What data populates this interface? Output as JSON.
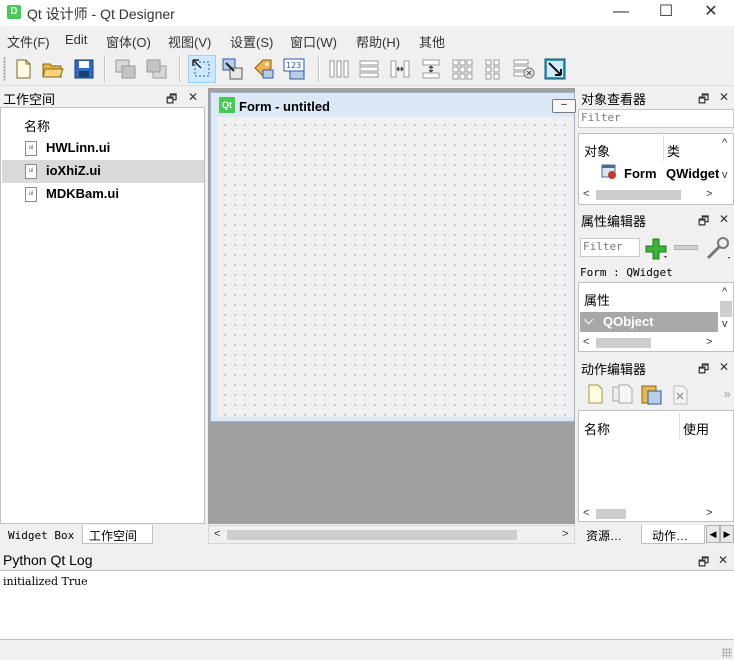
{
  "window": {
    "title": "Qt 设计师 - Qt Designer",
    "app_icon_letter": "D"
  },
  "window_controls": {
    "minimize": "—",
    "maximize": "☐",
    "close": "✕"
  },
  "menubar": {
    "items": [
      "文件(F)",
      "Edit",
      "窗体(O)",
      "视图(V)",
      "设置(S)",
      "窗口(W)",
      "帮助(H)",
      "其他"
    ]
  },
  "toolbar": {
    "buttons": [
      "new-form",
      "open-form",
      "save-form",
      "send-to-back",
      "bring-to-front",
      "edit-widgets",
      "edit-signals-slots",
      "edit-buddies",
      "edit-tab-order",
      "layout-horizontal",
      "layout-vertical",
      "layout-horizontal-splitter",
      "layout-vertical-splitter",
      "layout-grid",
      "layout-form",
      "break-layout",
      "adjust-size"
    ]
  },
  "workspace_dock": {
    "title": "工作空间",
    "column_header": "名称",
    "files": [
      {
        "name": "HWLinn.ui",
        "selected": false
      },
      {
        "name": "ioXhiZ.ui",
        "selected": true
      },
      {
        "name": "MDKBam.ui",
        "selected": false
      }
    ],
    "tabs": [
      "Widget Box",
      "工作空间"
    ],
    "active_tab": "工作空间"
  },
  "dock_controls": {
    "float": "🗗",
    "close": "✕"
  },
  "form_window": {
    "badge": "Qt",
    "title": "Form - untitled",
    "min_button": "–"
  },
  "object_inspector": {
    "title": "对象查看器",
    "filter_placeholder": "Filter",
    "columns": [
      "对象",
      "类"
    ],
    "rows": [
      {
        "object": "Form",
        "class": "QWidget"
      }
    ]
  },
  "property_editor": {
    "title": "属性编辑器",
    "filter_placeholder": "Filter",
    "context": "Form : QWidget",
    "column_header": "属性",
    "group": "QObject"
  },
  "action_editor": {
    "title": "动作编辑器",
    "columns": [
      "名称",
      "使用"
    ],
    "more": "»"
  },
  "right_tabs": {
    "items": [
      "资源…",
      "动作…"
    ]
  },
  "log": {
    "title": "Python Qt Log",
    "text": "initialized True"
  },
  "scroll_arrows": {
    "left": "<",
    "right": ">",
    "up": "^",
    "down": "v"
  },
  "colors": {
    "qt_green": "#41cd52",
    "selection": "#d9d9d9",
    "mdi_bg": "#a0a0a0",
    "canvas_bg": "#f0f0f0",
    "group_row": "#a8a8a8"
  }
}
